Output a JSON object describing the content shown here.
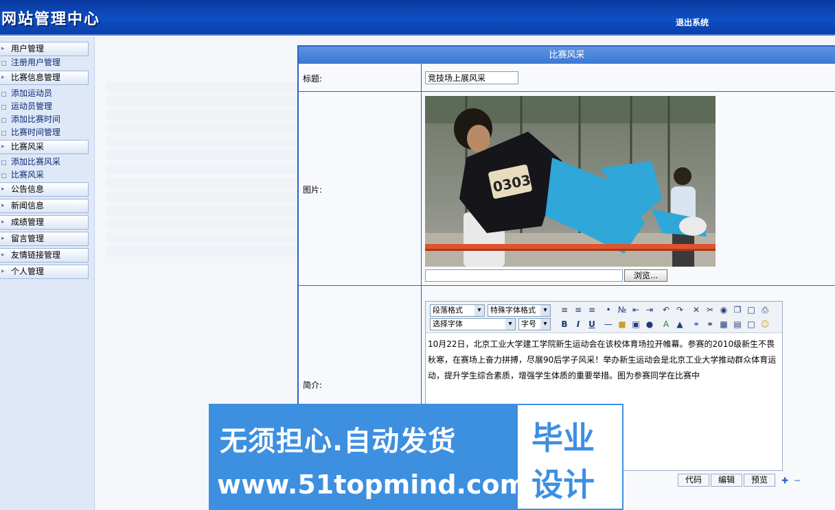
{
  "header": {
    "title": "网站管理中心",
    "logout": "退出系统"
  },
  "sidebar": {
    "groups": [
      {
        "label": "用户管理",
        "items": [
          "注册用户管理"
        ]
      },
      {
        "label": "比赛信息管理",
        "items": [
          "添加运动员",
          "运动员管理",
          "添加比赛时间",
          "比赛时间管理"
        ]
      },
      {
        "label": "比赛风采",
        "items": [
          "添加比赛风采",
          "比赛风采"
        ]
      },
      {
        "label": "公告信息",
        "items": []
      },
      {
        "label": "新闻信息",
        "items": []
      },
      {
        "label": "成绩管理",
        "items": []
      },
      {
        "label": "留言管理",
        "items": []
      },
      {
        "label": "友情链接管理",
        "items": []
      },
      {
        "label": "个人管理",
        "items": []
      }
    ]
  },
  "form": {
    "panel_title": "比赛风采",
    "title_label": "标题:",
    "title_value": "竞技场上展风采",
    "image_label": "图片:",
    "browse_label": "浏览...",
    "intro_label": "简介:",
    "photo_bib": "0303",
    "editor": {
      "paragraph_format": "段落格式",
      "special_format": "特殊字体格式",
      "font": "选择字体",
      "size": "字号",
      "content": "10月22日，北京工业大学建工学院新生运动会在该校体育场拉开帷幕。参赛的2010级新生不畏秋寒，在赛场上奋力拼搏，尽展90后学子风采！举办新生运动会是北京工业大学推动群众体育运动，提升学生综合素质，增强学生体质的重要举措。图为参赛同学在比赛中",
      "tabs": [
        "代码",
        "编辑",
        "预览"
      ]
    }
  },
  "banner": {
    "slogan": "无须担心.自动发货",
    "site": "www.51topmind.com",
    "box_line1": "毕业",
    "box_line2": "设计"
  }
}
